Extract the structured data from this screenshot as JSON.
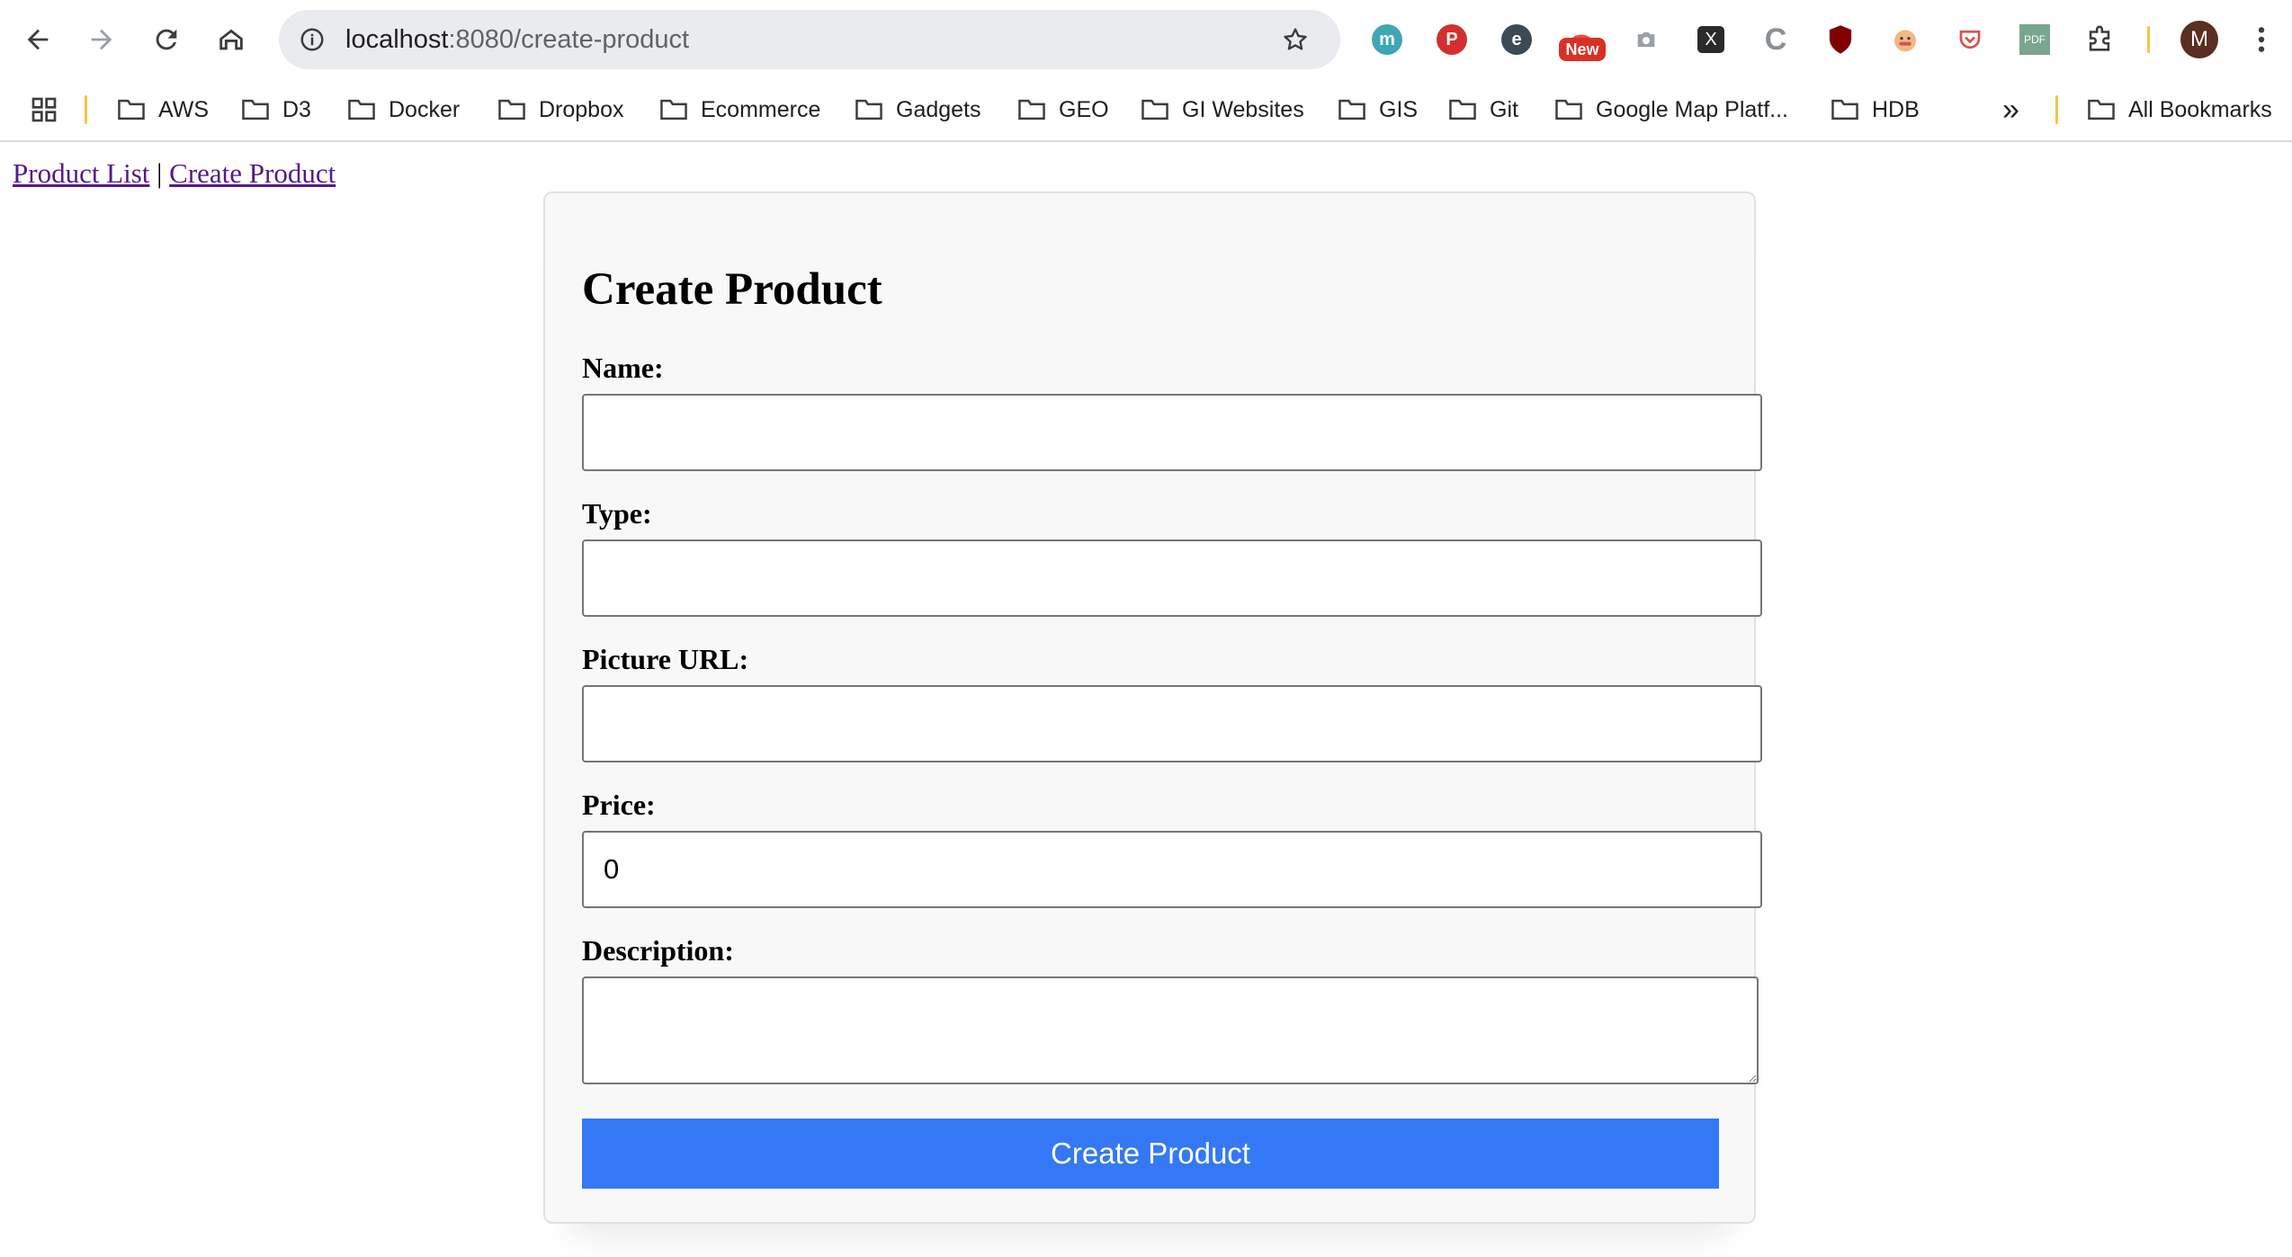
{
  "browser": {
    "url_host": "localhost",
    "url_path": ":8080/create-product",
    "extensions": {
      "new_badge": "New",
      "avatar_letter": "M",
      "pdf_label": "PDF",
      "m_ext_letter": "m"
    },
    "bookmarks": [
      {
        "label": "AWS"
      },
      {
        "label": "D3"
      },
      {
        "label": "Docker"
      },
      {
        "label": "Dropbox"
      },
      {
        "label": "Ecommerce"
      },
      {
        "label": "Gadgets"
      },
      {
        "label": "GEO"
      },
      {
        "label": "GI Websites"
      },
      {
        "label": "GIS"
      },
      {
        "label": "Git"
      },
      {
        "label": "Google Map Platf..."
      },
      {
        "label": "HDB"
      }
    ],
    "all_bookmarks": "All Bookmarks",
    "overflow_glyph": "»"
  },
  "page_nav": {
    "product_list": "Product List",
    "separator": "|",
    "create_product": "Create Product"
  },
  "form": {
    "title": "Create Product",
    "fields": {
      "name": {
        "label": "Name:",
        "value": ""
      },
      "type": {
        "label": "Type:",
        "value": ""
      },
      "picture_url": {
        "label": "Picture URL:",
        "value": ""
      },
      "price": {
        "label": "Price:",
        "value": "0"
      },
      "description": {
        "label": "Description:",
        "value": ""
      }
    },
    "submit_label": "Create Product"
  },
  "colors": {
    "submit_button": "#3478f6",
    "visited_link": "#551a8b",
    "card_background": "#f8f8f8"
  }
}
